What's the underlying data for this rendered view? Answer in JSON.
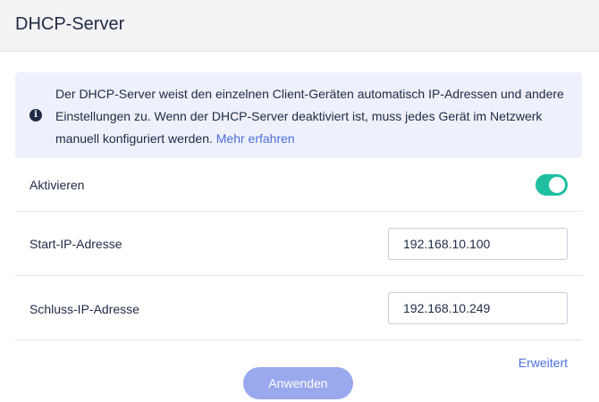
{
  "header": {
    "title": "DHCP-Server"
  },
  "info": {
    "icon": "info-icon",
    "text": "Der DHCP-Server weist den einzelnen Client-Geräten automatisch IP-Adressen und andere Einstellungen zu. Wenn der DHCP-Server deaktiviert ist, muss jedes Gerät im Netzwerk manuell konfiguriert werden.",
    "link_label": "Mehr erfahren"
  },
  "enable": {
    "label": "Aktivieren",
    "state": "on",
    "accent_color": "#1fbfa2"
  },
  "start_ip": {
    "label": "Start-IP-Adresse",
    "value": "192.168.10.100"
  },
  "end_ip": {
    "label": "Schluss-IP-Adresse",
    "value": "192.168.10.249"
  },
  "advanced": {
    "label": "Erweitert"
  },
  "apply": {
    "label": "Anwenden",
    "color": "#9aa8ee"
  }
}
